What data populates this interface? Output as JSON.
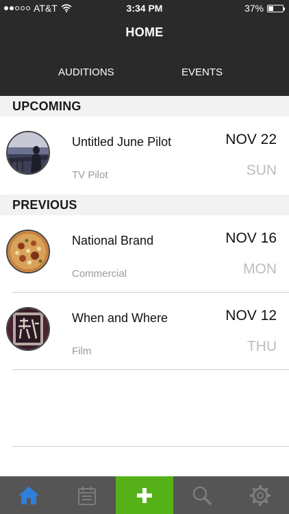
{
  "status_bar": {
    "carrier": "AT&T",
    "time": "3:34 PM",
    "battery": "37%",
    "battery_level": 0.37,
    "signal_bars": 2
  },
  "header": {
    "title": "HOME",
    "tabs": [
      {
        "label": "AUDITIONS"
      },
      {
        "label": "EVENTS"
      }
    ]
  },
  "sections": {
    "upcoming": {
      "label": "UPCOMING",
      "items": [
        {
          "title": "Untitled June Pilot",
          "type": "TV Pilot",
          "date": "NOV 22",
          "day": "SUN"
        }
      ]
    },
    "previous": {
      "label": "PREVIOUS",
      "items": [
        {
          "title": "National Brand",
          "type": "Commercial",
          "date": "NOV 16",
          "day": "MON"
        },
        {
          "title": "When and Where",
          "type": "Film",
          "date": "NOV 12",
          "day": "THU"
        }
      ]
    }
  },
  "tab_bar": {
    "items": [
      {
        "icon": "home-icon",
        "active": true
      },
      {
        "icon": "calendar-icon",
        "active": false
      },
      {
        "icon": "plus-icon",
        "active": false
      },
      {
        "icon": "search-icon",
        "active": false
      },
      {
        "icon": "gear-icon",
        "active": false
      }
    ]
  },
  "colors": {
    "header_bg": "#2a2a2a",
    "tabbar_bg": "#555555",
    "add_accent": "#55b117",
    "active_tab_icon": "#2f7fd9",
    "muted_text": "#9a9a9a",
    "day_text": "#bdbdbd"
  }
}
